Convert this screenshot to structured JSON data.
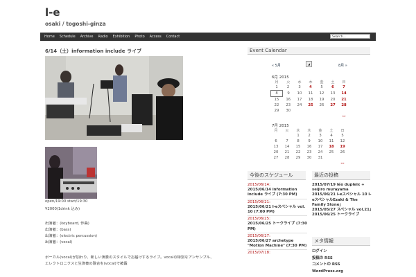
{
  "site": {
    "title": "l-e",
    "tagline": "osaki / togoshi-ginza"
  },
  "nav": {
    "items": [
      "Home",
      "Schedule",
      "Archive",
      "Radio",
      "Exhibition",
      "Photo",
      "Access",
      "Contact"
    ],
    "search_value": "Search..."
  },
  "post": {
    "title": "6/14（土）information include ライブ",
    "lines": [
      "open/19:00 start/19:30",
      "¥2000(1drink 込み)",
      "",
      "出演者：(keyboard, 作曲)",
      "出演者：(bass)",
      "出演者：(electric percussion)",
      "出演者：(vocal)",
      "",
      "ボーカル(vocal)が加わり、新しい演奏のスタイルでお届けするライブ。vocalの特別なアンサンブル、",
      "エレクトロニクスと生演奏の融合を(vocal)で披露"
    ]
  },
  "calendar": {
    "title": "Event Calendar",
    "nav_prev": "« 5月",
    "nav_next": "8月 »",
    "weekdays": [
      "月",
      "火",
      "水",
      "木",
      "金",
      "土",
      "日"
    ],
    "june": {
      "caption": "6月 2015",
      "weeks": [
        [
          "1",
          "2",
          "3",
          "4",
          "5",
          "6",
          "7"
        ],
        [
          "8",
          "9",
          "10",
          "11",
          "12",
          "13",
          "14"
        ],
        [
          "15",
          "16",
          "17",
          "18",
          "19",
          "20",
          "21"
        ],
        [
          "22",
          "23",
          "24",
          "25",
          "26",
          "27",
          "28"
        ],
        [
          "29",
          "30",
          "",
          "",
          "",
          "",
          ""
        ]
      ],
      "events": [
        "4",
        "6",
        "7",
        "14",
        "21",
        "25",
        "27",
        "28"
      ],
      "today": "8"
    },
    "july": {
      "caption": "7月 2015",
      "weeks": [
        [
          "",
          "",
          "1",
          "2",
          "3",
          "4",
          "5"
        ],
        [
          "6",
          "7",
          "8",
          "9",
          "10",
          "11",
          "12"
        ],
        [
          "13",
          "14",
          "15",
          "16",
          "17",
          "18",
          "19"
        ],
        [
          "20",
          "21",
          "22",
          "23",
          "24",
          "25",
          "26"
        ],
        [
          "27",
          "28",
          "29",
          "30",
          "31",
          "",
          ""
        ]
      ],
      "events": [
        "18",
        "19"
      ]
    },
    "footer_link": "«»"
  },
  "upcoming": {
    "title": "今後のスケジュール",
    "items": [
      {
        "date": "2015/06/14:",
        "entry": "2015/06/14 information include ライブ (7:30 PM)"
      },
      {
        "date": "2015/06/21:",
        "entry": "2015/06/21 l-eスペシャル vol. 10 (7:00 PM)"
      },
      {
        "date": "2015/06/25:",
        "entry": "2015/06/25 トークライブ (7:30 PM)"
      },
      {
        "date": "2015/06/27:",
        "entry": "2015/06/27 archetype \"Motion Machine\" (7:30 PM)"
      },
      {
        "date": "2015/07/18:",
        "entry": ""
      }
    ]
  },
  "recent": {
    "title": "最近の投稿",
    "items": [
      "2015/07/19 léo dupleix + seijiro murayama",
      "2015/06/21 l-eスペシャル 10 l-eスペシャルEzaki & The Family Stone」",
      "2015/05/27 スペシャル vol.21」",
      "2015/06/25 トークライブ"
    ]
  },
  "meta": {
    "title": "メタ情報",
    "items": [
      "ログイン",
      "投稿の RSS",
      "コメントの RSS",
      "WordPress.org"
    ]
  }
}
